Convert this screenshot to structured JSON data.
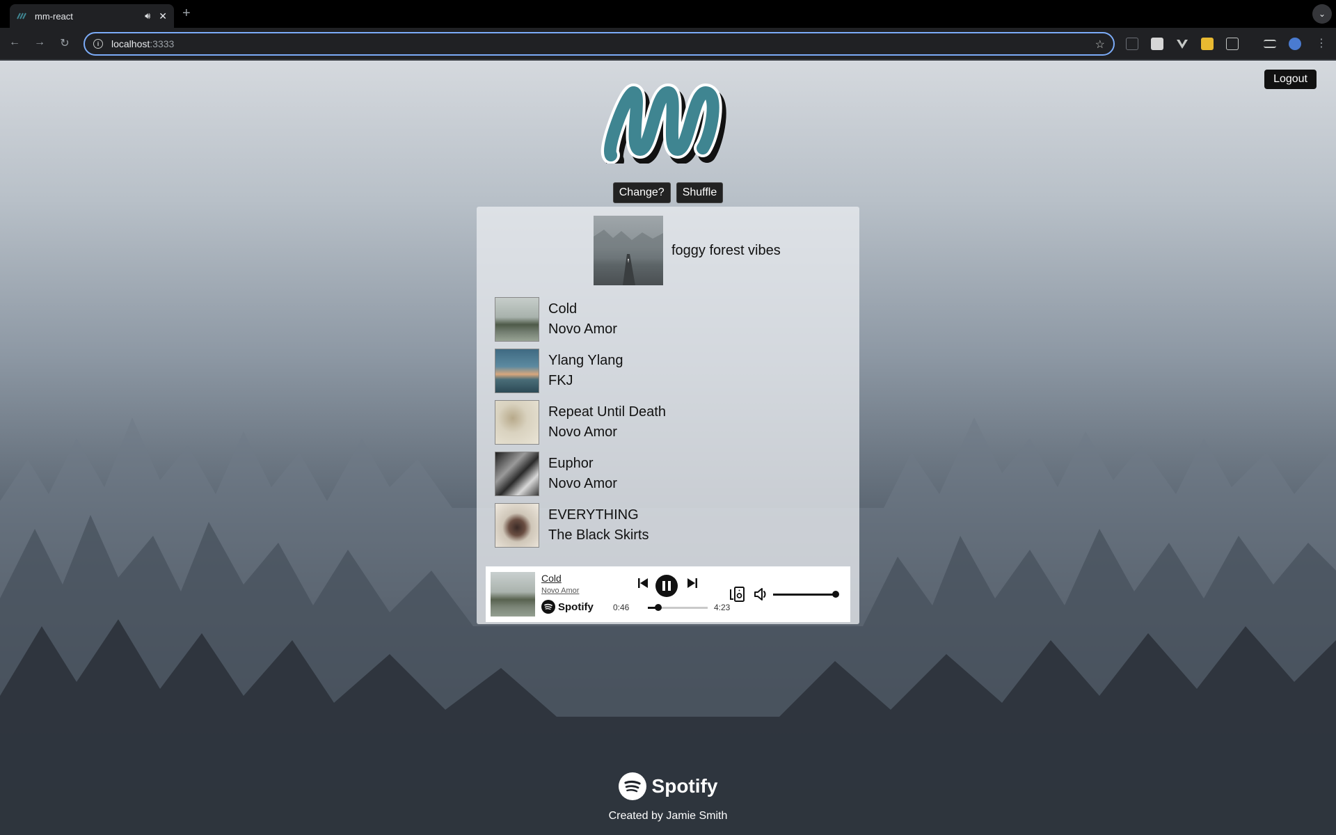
{
  "browser": {
    "tab_title": "mm-react",
    "tab_sound_icon": "speaker-icon",
    "url_host": "localhost",
    "url_port": ":3333",
    "accent_color": "#7cacf8"
  },
  "header": {
    "logout_label": "Logout",
    "logo_colors": {
      "fill": "#3f8591",
      "stroke": "#ffffff",
      "shadow": "#111111"
    }
  },
  "actions": {
    "change_label": "Change?",
    "shuffle_label": "Shuffle"
  },
  "playlist": {
    "name": "foggy forest vibes",
    "tracks": [
      {
        "title": "Cold",
        "artist": "Novo Amor"
      },
      {
        "title": "Ylang Ylang",
        "artist": "FKJ"
      },
      {
        "title": "Repeat Until Death",
        "artist": "Novo Amor"
      },
      {
        "title": "Euphor",
        "artist": "Novo Amor"
      },
      {
        "title": "EVERYTHING",
        "artist": "The Black Skirts"
      }
    ]
  },
  "player": {
    "title": "Cold",
    "artist": "Novo Amor",
    "brand": "Spotify",
    "elapsed": "0:46",
    "duration": "4:23",
    "progress_fraction": 0.18,
    "volume_fraction": 1.0
  },
  "footer": {
    "brand": "Spotify",
    "credit": "Created by Jamie Smith"
  }
}
